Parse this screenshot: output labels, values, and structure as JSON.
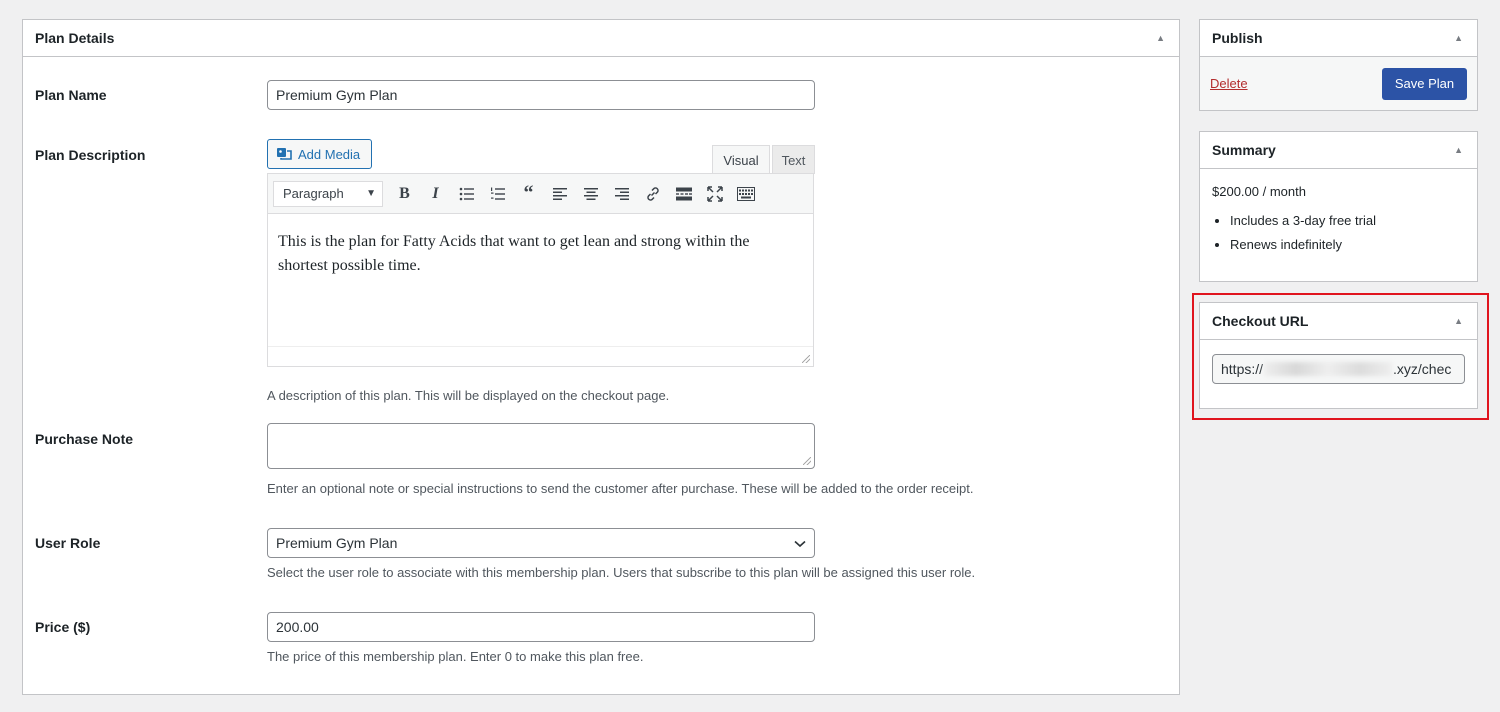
{
  "plan_details": {
    "title": "Plan Details",
    "plan_name": {
      "label": "Plan Name",
      "value": "Premium Gym Plan"
    },
    "plan_description": {
      "label": "Plan Description",
      "add_media_label": "Add Media",
      "tab_visual": "Visual",
      "tab_text": "Text",
      "format_select": "Paragraph",
      "content": "This is the plan for Fatty Acids that want to get lean and strong within the shortest possible time.",
      "help": "A description of this plan. This will be displayed on the checkout page."
    },
    "purchase_note": {
      "label": "Purchase Note",
      "value": "",
      "help": "Enter an optional note or special instructions to send the customer after purchase. These will be added to the order receipt."
    },
    "user_role": {
      "label": "User Role",
      "value": "Premium Gym Plan",
      "help": "Select the user role to associate with this membership plan. Users that subscribe to this plan will be assigned this user role."
    },
    "price": {
      "label": "Price ($)",
      "value": "200.00",
      "help": "The price of this membership plan. Enter 0 to make this plan free."
    }
  },
  "publish": {
    "title": "Publish",
    "delete_label": "Delete",
    "save_label": "Save Plan"
  },
  "summary": {
    "title": "Summary",
    "price_text": "$200.00 / month",
    "items": [
      "Includes a 3-day free trial",
      "Renews indefinitely"
    ]
  },
  "checkout": {
    "title": "Checkout URL",
    "url_prefix": "https://",
    "url_suffix": ".xyz/chec"
  },
  "colors": {
    "accent": "#2271b1",
    "save_button": "#2c53a6",
    "delete_link": "#b32d2e",
    "highlight": "#e0141e"
  }
}
